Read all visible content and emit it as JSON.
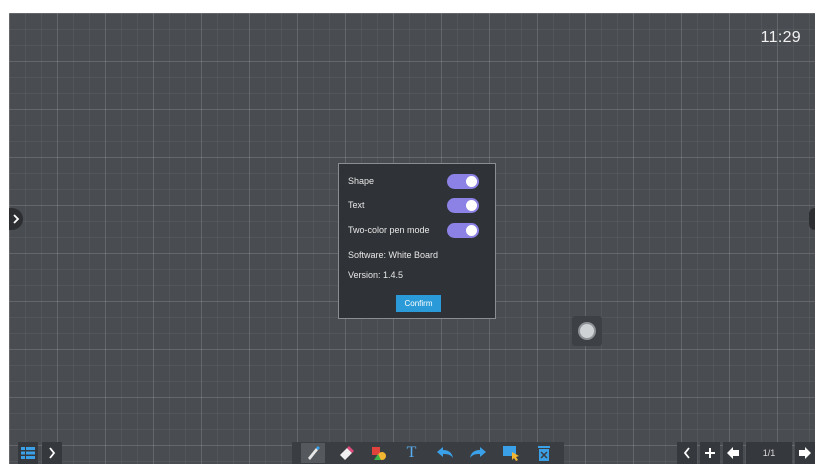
{
  "clock": "11:29",
  "dialog": {
    "settings": [
      {
        "label": "Shape",
        "enabled": true
      },
      {
        "label": "Text",
        "enabled": true
      },
      {
        "label": "Two-color pen mode",
        "enabled": true
      }
    ],
    "software": "Software: White Board",
    "version": "Version: 1.4.5",
    "confirm_label": "Confirm"
  },
  "page_indicator": "1/1",
  "toolbar": {
    "tools": [
      "pen-icon",
      "eraser-icon",
      "shape-icon",
      "text-icon",
      "undo-icon",
      "redo-icon",
      "select-icon",
      "delete-icon"
    ],
    "text_tool_glyph": "T"
  },
  "colors": {
    "board": "#494c50",
    "toggle_on": "#8c82e6",
    "confirm": "#2a9bd8"
  }
}
